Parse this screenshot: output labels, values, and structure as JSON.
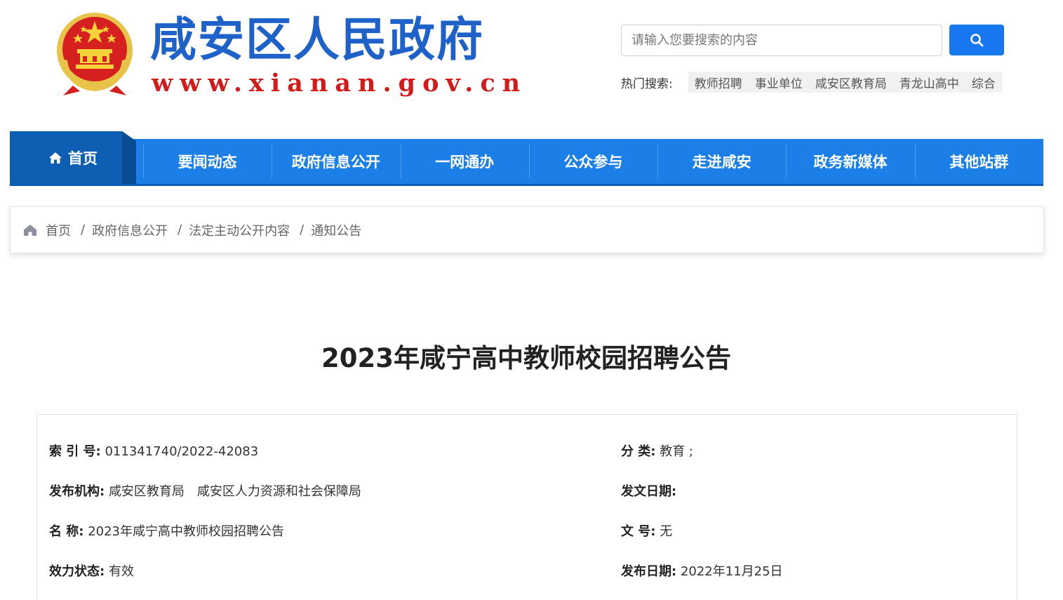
{
  "header": {
    "site_title": "咸安区人民政府",
    "site_url": "www.xianan.gov.cn",
    "search_placeholder": "请输入您要搜索的内容",
    "hot_label": "热门搜索:",
    "hot_tags": [
      "教师招聘",
      "事业单位",
      "咸安区教育局",
      "青龙山高中",
      "综合"
    ]
  },
  "nav": {
    "home": "首页",
    "items": [
      "要闻动态",
      "政府信息公开",
      "一网通办",
      "公众参与",
      "走进咸安",
      "政务新媒体",
      "其他站群"
    ]
  },
  "breadcrumb": [
    "首页",
    "政府信息公开",
    "法定主动公开内容",
    "通知公告"
  ],
  "article": {
    "title": "2023年咸宁高中教师校园招聘公告"
  },
  "meta": {
    "index_label": "索 引 号:",
    "index_value": "011341740/2022-42083",
    "category_label": "分 类:",
    "category_value": "教育 ;",
    "org_label": "发布机构:",
    "org_value": "咸安区教育局　咸安区人力资源和社会保障局",
    "issue_date_label": "发文日期:",
    "issue_date_value": "",
    "name_label": "名 称:",
    "name_value": "2023年咸宁高中教师校园招聘公告",
    "doc_no_label": "文 号:",
    "doc_no_value": "无",
    "status_label": "效力状态:",
    "status_value": "有效",
    "pub_date_label": "发布日期:",
    "pub_date_value": "2022年11月25日"
  },
  "colors": {
    "brand_blue": "#1c7fe8",
    "nav_home": "#0e5fb4",
    "title_blue": "#1e62c9",
    "url_red": "#d11c1c",
    "search_btn": "#1677f0"
  },
  "icons": {
    "emblem": "national-emblem-icon",
    "search": "search-icon",
    "home": "home-icon",
    "crumb_home": "house-icon"
  }
}
